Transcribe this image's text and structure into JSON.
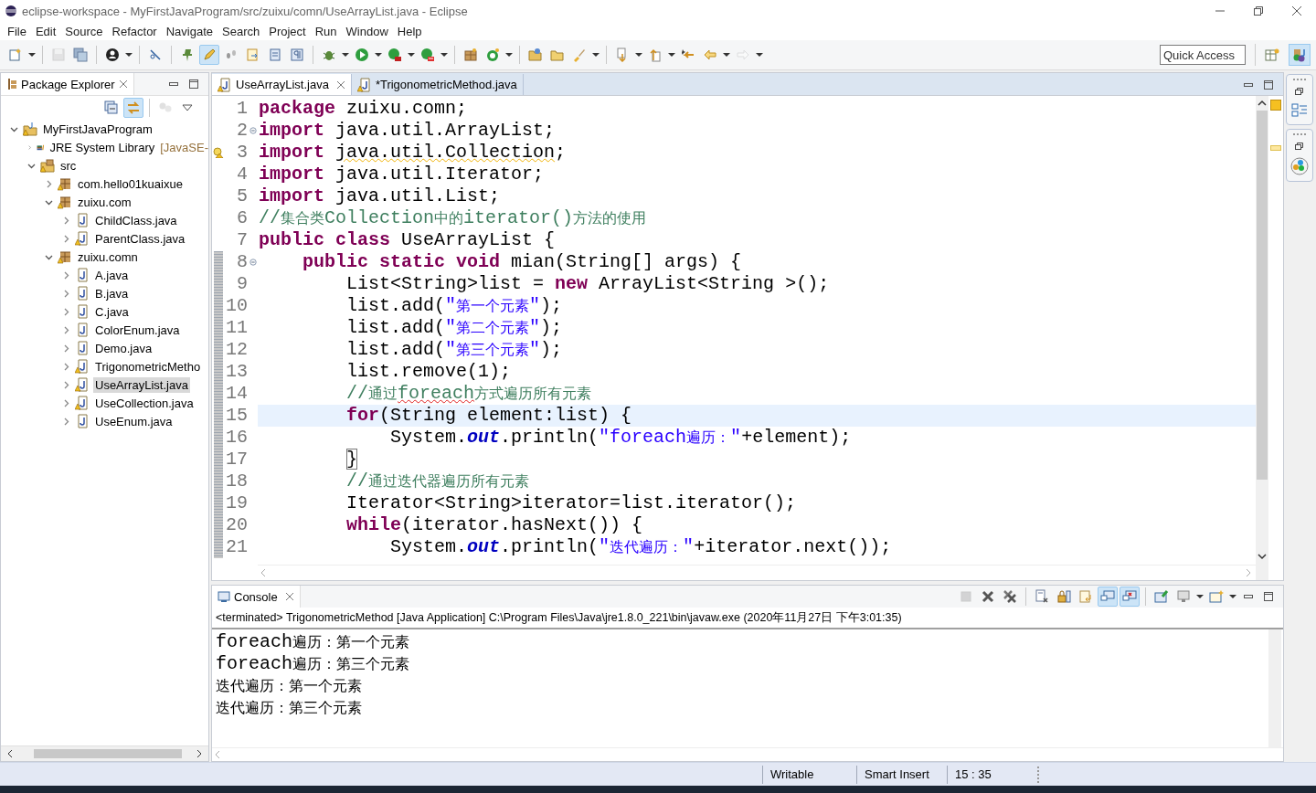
{
  "window": {
    "title": "eclipse-workspace - MyFirstJavaProgram/src/zuixu/comn/UseArrayList.java - Eclipse"
  },
  "menu": [
    "File",
    "Edit",
    "Source",
    "Refactor",
    "Navigate",
    "Search",
    "Project",
    "Run",
    "Window",
    "Help"
  ],
  "toolbar": [
    {
      "kind": "new",
      "dropdown": true,
      "pressed": false,
      "disabled": false
    },
    {
      "kind": "separator"
    },
    {
      "kind": "save",
      "dropdown": false,
      "pressed": false,
      "disabled": true
    },
    {
      "kind": "save-all",
      "dropdown": false,
      "pressed": false,
      "disabled": false
    },
    {
      "kind": "separator"
    },
    {
      "kind": "person",
      "dropdown": true,
      "pressed": false,
      "disabled": false
    },
    {
      "kind": "separator"
    },
    {
      "kind": "unlink",
      "dropdown": false,
      "pressed": false,
      "disabled": false
    },
    {
      "kind": "separator"
    },
    {
      "kind": "pin",
      "dropdown": false,
      "pressed": false,
      "disabled": false
    },
    {
      "kind": "pen",
      "dropdown": false,
      "pressed": true,
      "disabled": false
    },
    {
      "kind": "footprints",
      "dropdown": false,
      "pressed": false,
      "disabled": false
    },
    {
      "kind": "doc-arrow",
      "dropdown": false,
      "pressed": false,
      "disabled": false
    },
    {
      "kind": "document",
      "dropdown": false,
      "pressed": false,
      "disabled": false
    },
    {
      "kind": "pilcrow",
      "dropdown": false,
      "pressed": false,
      "disabled": false
    },
    {
      "kind": "separator"
    },
    {
      "kind": "bug",
      "dropdown": true,
      "pressed": false,
      "disabled": false
    },
    {
      "kind": "run",
      "dropdown": true,
      "pressed": false,
      "disabled": false
    },
    {
      "kind": "run-ext",
      "dropdown": true,
      "pressed": false,
      "disabled": false
    },
    {
      "kind": "coverage",
      "dropdown": true,
      "pressed": false,
      "disabled": false
    },
    {
      "kind": "separator"
    },
    {
      "kind": "package",
      "dropdown": false,
      "pressed": false,
      "disabled": false
    },
    {
      "kind": "refresh",
      "dropdown": true,
      "pressed": false,
      "disabled": false
    },
    {
      "kind": "separator"
    },
    {
      "kind": "folder-open",
      "dropdown": false,
      "pressed": false,
      "disabled": false
    },
    {
      "kind": "folder",
      "dropdown": false,
      "pressed": false,
      "disabled": false
    },
    {
      "kind": "brush",
      "dropdown": true,
      "pressed": false,
      "disabled": false
    },
    {
      "kind": "separator"
    },
    {
      "kind": "arrow-down",
      "dropdown": true,
      "pressed": false,
      "disabled": false
    },
    {
      "kind": "arrow-up",
      "dropdown": true,
      "pressed": false,
      "disabled": false
    },
    {
      "kind": "last-edit",
      "dropdown": false,
      "pressed": false,
      "disabled": false
    },
    {
      "kind": "back",
      "dropdown": true,
      "pressed": false,
      "disabled": false
    },
    {
      "kind": "forward",
      "dropdown": true,
      "pressed": false,
      "disabled": true
    }
  ],
  "quick_access": {
    "placeholder": "Quick Access"
  },
  "perspectives": [
    {
      "kind": "open-perspective",
      "selected": false
    },
    {
      "kind": "java",
      "selected": true
    }
  ],
  "package_explorer": {
    "title": "Package Explorer",
    "toolbar": [
      {
        "kind": "collapse",
        "dropdown": false,
        "pressed": false,
        "disabled": false
      },
      {
        "kind": "link",
        "dropdown": false,
        "pressed": true,
        "disabled": false
      },
      {
        "kind": "separator"
      },
      {
        "kind": "filter",
        "dropdown": false,
        "pressed": false,
        "disabled": true
      },
      {
        "kind": "view-menu",
        "dropdown": false,
        "pressed": false,
        "disabled": false
      }
    ],
    "tree": [
      {
        "label": "MyFirstJavaProgram",
        "kind": "project",
        "warning": true,
        "expanded": true,
        "selected": false,
        "children": [
          {
            "label": "JRE System Library",
            "decoration": "[JavaSE-",
            "kind": "library",
            "warning": false,
            "expanded": false,
            "selected": false
          },
          {
            "label": "src",
            "kind": "source-folder",
            "warning": true,
            "expanded": true,
            "selected": false,
            "children": [
              {
                "label": "com.hello01kuaixue",
                "kind": "package",
                "warning": true,
                "expanded": false,
                "selected": false
              },
              {
                "label": "zuixu.com",
                "kind": "package",
                "warning": true,
                "expanded": true,
                "selected": false,
                "children": [
                  {
                    "label": "ChildClass.java",
                    "kind": "java",
                    "warning": false,
                    "expanded": false,
                    "selected": false
                  },
                  {
                    "label": "ParentClass.java",
                    "kind": "java",
                    "warning": true,
                    "expanded": false,
                    "selected": false
                  }
                ]
              },
              {
                "label": "zuixu.comn",
                "kind": "package",
                "warning": true,
                "expanded": true,
                "selected": false,
                "children": [
                  {
                    "label": "A.java",
                    "kind": "java",
                    "warning": false,
                    "expanded": false,
                    "selected": false
                  },
                  {
                    "label": "B.java",
                    "kind": "java",
                    "warning": false,
                    "expanded": false,
                    "selected": false
                  },
                  {
                    "label": "C.java",
                    "kind": "java",
                    "warning": false,
                    "expanded": false,
                    "selected": false
                  },
                  {
                    "label": "ColorEnum.java",
                    "kind": "java",
                    "warning": false,
                    "expanded": false,
                    "selected": false
                  },
                  {
                    "label": "Demo.java",
                    "kind": "java",
                    "warning": false,
                    "expanded": false,
                    "selected": false
                  },
                  {
                    "label": "TrigonometricMetho",
                    "kind": "java",
                    "warning": true,
                    "expanded": false,
                    "selected": false
                  },
                  {
                    "label": "UseArrayList.java",
                    "kind": "java",
                    "warning": true,
                    "expanded": false,
                    "selected": true
                  },
                  {
                    "label": "UseCollection.java",
                    "kind": "java",
                    "warning": true,
                    "expanded": false,
                    "selected": false
                  },
                  {
                    "label": "UseEnum.java",
                    "kind": "java",
                    "warning": false,
                    "expanded": false,
                    "selected": false
                  }
                ]
              }
            ]
          }
        ]
      }
    ]
  },
  "editor": {
    "tabs": [
      {
        "label": "UseArrayList.java",
        "warning": true,
        "closable": true,
        "selected": true
      },
      {
        "label": "*TrigonometricMethod.java",
        "warning": true,
        "closable": false,
        "selected": false
      }
    ],
    "lines": [
      {
        "number": "1",
        "foldable": false,
        "warning": false,
        "current": false,
        "in_range": false,
        "tokens": [
          {
            "kind": "keyword",
            "text": "package"
          },
          {
            "kind": "plain",
            "text": " zuixu.comn;"
          }
        ]
      },
      {
        "number": "2",
        "foldable": true,
        "warning": false,
        "current": false,
        "in_range": false,
        "tokens": [
          {
            "kind": "keyword",
            "text": "import"
          },
          {
            "kind": "plain",
            "text": " java.util.ArrayList;"
          }
        ]
      },
      {
        "number": "3",
        "foldable": false,
        "warning": true,
        "current": false,
        "in_range": false,
        "tokens": [
          {
            "kind": "keyword",
            "text": "import "
          },
          {
            "kind": "plain",
            "text": "java.util.Collection",
            "warning_underline": true
          },
          {
            "kind": "plain",
            "text": ";"
          }
        ]
      },
      {
        "number": "4",
        "foldable": false,
        "warning": false,
        "current": false,
        "in_range": false,
        "tokens": [
          {
            "kind": "keyword",
            "text": "import"
          },
          {
            "kind": "plain",
            "text": " java.util.Iterator;"
          }
        ]
      },
      {
        "number": "5",
        "foldable": false,
        "warning": false,
        "current": false,
        "in_range": false,
        "tokens": [
          {
            "kind": "keyword",
            "text": "import"
          },
          {
            "kind": "plain",
            "text": " java.util.List;"
          }
        ]
      },
      {
        "number": "6",
        "foldable": false,
        "warning": false,
        "current": false,
        "in_range": false,
        "tokens": [
          {
            "kind": "comment",
            "text": "//集合类Collection中的iterator()方法的使用"
          }
        ]
      },
      {
        "number": "7",
        "foldable": false,
        "warning": false,
        "current": false,
        "in_range": false,
        "tokens": [
          {
            "kind": "keyword",
            "text": "public class"
          },
          {
            "kind": "plain",
            "text": " UseArrayList {"
          }
        ]
      },
      {
        "number": "8",
        "foldable": true,
        "warning": false,
        "current": false,
        "in_range": true,
        "tokens": [
          {
            "kind": "keyword",
            "text": "    public static void"
          },
          {
            "kind": "plain",
            "text": " mian(String[] args) {"
          }
        ]
      },
      {
        "number": "9",
        "foldable": false,
        "warning": false,
        "current": false,
        "in_range": true,
        "tokens": [
          {
            "kind": "plain",
            "text": "        List<String>list = "
          },
          {
            "kind": "keyword",
            "text": "new"
          },
          {
            "kind": "plain",
            "text": " ArrayList<String >();"
          }
        ]
      },
      {
        "number": "10",
        "foldable": false,
        "warning": false,
        "current": false,
        "in_range": true,
        "tokens": [
          {
            "kind": "plain",
            "text": "        list.add("
          },
          {
            "kind": "string",
            "text": "\"第一个元素\""
          },
          {
            "kind": "plain",
            "text": ");"
          }
        ]
      },
      {
        "number": "11",
        "foldable": false,
        "warning": false,
        "current": false,
        "in_range": true,
        "tokens": [
          {
            "kind": "plain",
            "text": "        list.add("
          },
          {
            "kind": "string",
            "text": "\"第二个元素\""
          },
          {
            "kind": "plain",
            "text": ");"
          }
        ]
      },
      {
        "number": "12",
        "foldable": false,
        "warning": false,
        "current": false,
        "in_range": true,
        "tokens": [
          {
            "kind": "plain",
            "text": "        list.add("
          },
          {
            "kind": "string",
            "text": "\"第三个元素\""
          },
          {
            "kind": "plain",
            "text": ");"
          }
        ]
      },
      {
        "number": "13",
        "foldable": false,
        "warning": false,
        "current": false,
        "in_range": true,
        "tokens": [
          {
            "kind": "plain",
            "text": "        list.remove(1);"
          }
        ]
      },
      {
        "number": "14",
        "foldable": false,
        "warning": false,
        "current": false,
        "in_range": true,
        "tokens": [
          {
            "kind": "comment",
            "text": "        //通过"
          },
          {
            "kind": "comment",
            "text": "foreach",
            "misspelled": true
          },
          {
            "kind": "comment",
            "text": "方式遍历所有元素"
          }
        ]
      },
      {
        "number": "15",
        "foldable": false,
        "warning": false,
        "current": true,
        "in_range": true,
        "tokens": [
          {
            "kind": "keyword",
            "text": "        for"
          },
          {
            "kind": "plain",
            "text": "(String element:list) {"
          }
        ]
      },
      {
        "number": "16",
        "foldable": false,
        "warning": false,
        "current": false,
        "in_range": true,
        "tokens": [
          {
            "kind": "plain",
            "text": "            System."
          },
          {
            "kind": "static-field",
            "text": "out"
          },
          {
            "kind": "plain",
            "text": ".println("
          },
          {
            "kind": "string",
            "text": "\"foreach遍历：\""
          },
          {
            "kind": "plain",
            "text": "+element);"
          }
        ]
      },
      {
        "number": "17",
        "foldable": false,
        "warning": false,
        "current": false,
        "in_range": true,
        "tokens": [
          {
            "kind": "plain",
            "text": "        }",
            "bracket_match": true
          }
        ]
      },
      {
        "number": "18",
        "foldable": false,
        "warning": false,
        "current": false,
        "in_range": true,
        "tokens": [
          {
            "kind": "comment",
            "text": "        //通过迭代器遍历所有元素"
          }
        ]
      },
      {
        "number": "19",
        "foldable": false,
        "warning": false,
        "current": false,
        "in_range": true,
        "tokens": [
          {
            "kind": "plain",
            "text": "        Iterator<String>iterator=list.iterator();"
          }
        ]
      },
      {
        "number": "20",
        "foldable": false,
        "warning": false,
        "current": false,
        "in_range": true,
        "tokens": [
          {
            "kind": "keyword",
            "text": "        while"
          },
          {
            "kind": "plain",
            "text": "(iterator.hasNext()) {"
          }
        ]
      },
      {
        "number": "21",
        "foldable": false,
        "warning": false,
        "current": false,
        "in_range": true,
        "tokens": [
          {
            "kind": "plain",
            "text": "            System."
          },
          {
            "kind": "static-field",
            "text": "out"
          },
          {
            "kind": "plain",
            "text": ".println("
          },
          {
            "kind": "string",
            "text": "\"迭代遍历：\""
          },
          {
            "kind": "plain",
            "text": "+iterator.next());"
          }
        ]
      }
    ]
  },
  "console": {
    "title": "Console",
    "toolbar": [
      {
        "kind": "stop",
        "dropdown": false,
        "pressed": false,
        "disabled": true
      },
      {
        "kind": "remove",
        "dropdown": false,
        "pressed": false,
        "disabled": false
      },
      {
        "kind": "remove-all",
        "dropdown": false,
        "pressed": false,
        "disabled": false
      },
      {
        "kind": "separator"
      },
      {
        "kind": "clear",
        "dropdown": false,
        "pressed": false,
        "disabled": false
      },
      {
        "kind": "scroll-lock",
        "dropdown": false,
        "pressed": false,
        "disabled": false
      },
      {
        "kind": "word-wrap",
        "dropdown": false,
        "pressed": false,
        "disabled": false
      },
      {
        "kind": "show-out",
        "dropdown": false,
        "pressed": true,
        "disabled": false
      },
      {
        "kind": "show-err",
        "dropdown": false,
        "pressed": true,
        "disabled": false
      },
      {
        "kind": "separator"
      },
      {
        "kind": "pin-console",
        "dropdown": false,
        "pressed": false,
        "disabled": false
      },
      {
        "kind": "monitor",
        "dropdown": true,
        "pressed": false,
        "disabled": false
      },
      {
        "kind": "new-console",
        "dropdown": true,
        "pressed": false,
        "disabled": false
      }
    ],
    "description": "<terminated> TrigonometricMethod [Java Application] C:\\Program Files\\Java\\jre1.8.0_221\\bin\\javaw.exe (2020年11月27日 下午3:01:35)",
    "output": [
      "foreach遍历：第一个元素",
      "foreach遍历：第三个元素",
      "迭代遍历：第一个元素",
      "迭代遍历：第三个元素"
    ]
  },
  "status_bar": [
    "Writable",
    "Smart Insert",
    "15 : 35"
  ]
}
